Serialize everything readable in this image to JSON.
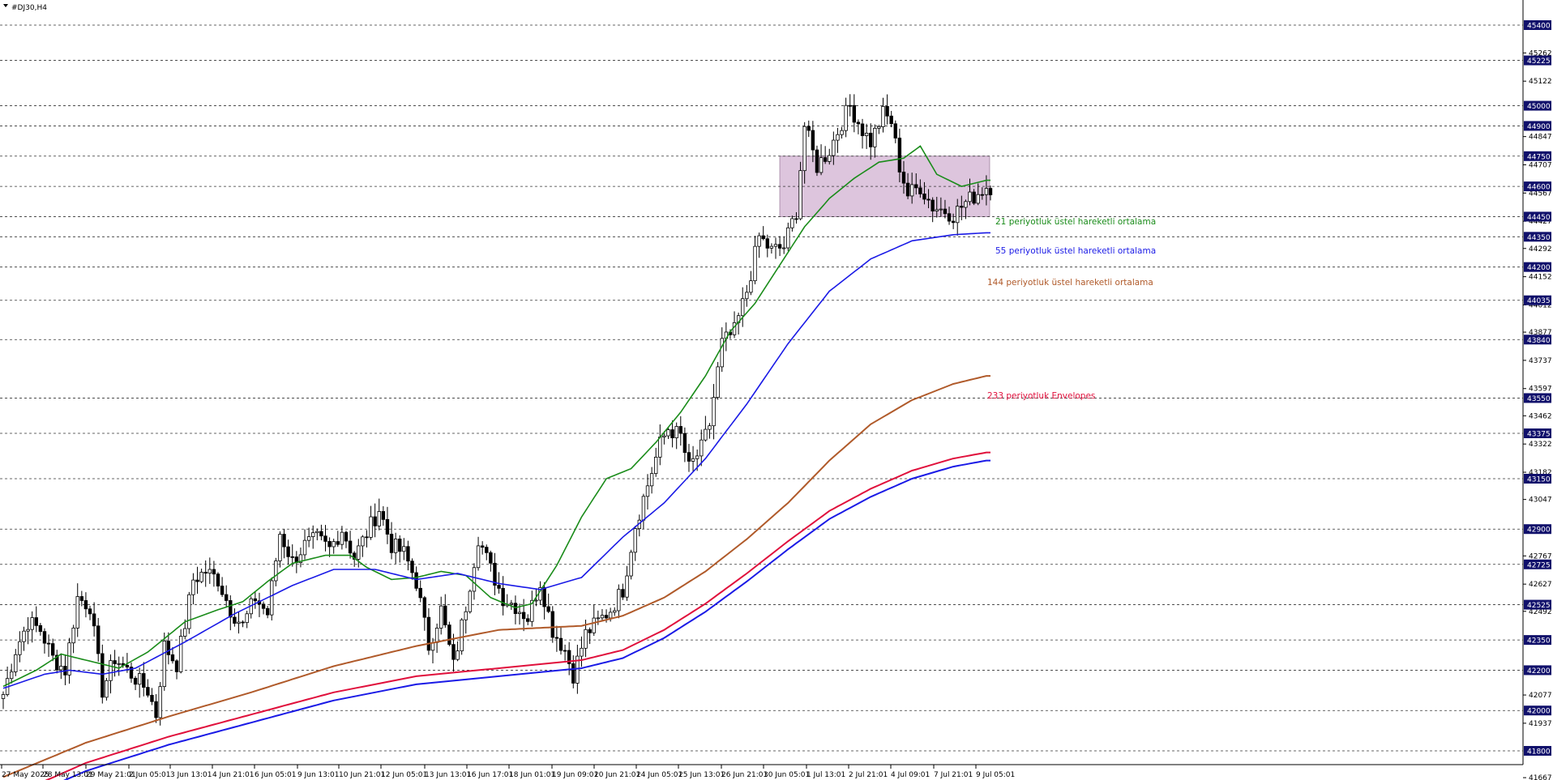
{
  "window": {
    "title": "#DJ30,H4"
  },
  "chart_data": {
    "type": "candlestick",
    "symbol": "#DJ30",
    "timeframe": "H4",
    "grid": false,
    "ylim": [
      41640,
      45560
    ],
    "price_levels": [
      45400,
      45225,
      45000,
      44900,
      44750,
      44600,
      44450,
      44350,
      44200,
      44035,
      43840,
      43550,
      43375,
      43150,
      42900,
      42725,
      42525,
      42350,
      42200,
      42000,
      41800
    ],
    "y_ticks": [
      45262,
      45122,
      44847,
      44707,
      44567,
      44427,
      44292,
      44152,
      44012,
      43877,
      43737,
      43597,
      43462,
      43322,
      43182,
      43047,
      42767,
      42627,
      42492,
      42077,
      41937,
      41667
    ],
    "x_ticks": [
      "27 May 2025",
      "28 May 13:01",
      "29 May 21:01",
      "2 Jun 05:01",
      "3 Jun 13:01",
      "4 Jun 21:01",
      "6 Jun 05:01",
      "9 Jun 13:01",
      "10 Jun 21:01",
      "12 Jun 05:01",
      "13 Jun 13:01",
      "16 Jun 17:01",
      "18 Jun 01:01",
      "19 Jun 09:01",
      "20 Jun 21:01",
      "24 Jun 05:01",
      "25 Jun 13:01",
      "26 Jun 21:01",
      "30 Jun 05:01",
      "1 Jul 13:01",
      "2 Jul 21:01",
      "4 Jul 09:01",
      "7 Jul 21:01",
      "9 Jul 05:01"
    ],
    "zone": {
      "from": 44450,
      "to": 44750,
      "color": "#d8bcd8"
    },
    "annotations": [
      {
        "text": "21 periyotluk üstel hareketli ortalama",
        "color": "#1a8c1a"
      },
      {
        "text": "55 periyotluk üstel hareketli ortalama",
        "color": "#1a1ae6"
      },
      {
        "text": "144 periyotluk üstel hareketli ortalama",
        "color": "#b05a2a"
      },
      {
        "text": "233 periyotluk Envelopes",
        "color": "#e0103c"
      }
    ],
    "series": [
      {
        "name": "21 periyotluk üstel hareketli ortalama",
        "color": "#1a8c1a",
        "anchors": [
          [
            0,
            42120
          ],
          [
            8,
            42200
          ],
          [
            14,
            42280
          ],
          [
            20,
            42250
          ],
          [
            28,
            42210
          ],
          [
            35,
            42290
          ],
          [
            44,
            42440
          ],
          [
            52,
            42500
          ],
          [
            58,
            42540
          ],
          [
            64,
            42640
          ],
          [
            70,
            42730
          ],
          [
            78,
            42770
          ],
          [
            84,
            42770
          ],
          [
            88,
            42710
          ],
          [
            94,
            42650
          ],
          [
            100,
            42660
          ],
          [
            106,
            42690
          ],
          [
            112,
            42670
          ],
          [
            118,
            42560
          ],
          [
            124,
            42510
          ],
          [
            128,
            42530
          ],
          [
            134,
            42720
          ],
          [
            140,
            42960
          ],
          [
            146,
            43150
          ],
          [
            152,
            43200
          ],
          [
            158,
            43330
          ],
          [
            164,
            43480
          ],
          [
            170,
            43660
          ],
          [
            176,
            43880
          ],
          [
            182,
            44020
          ],
          [
            188,
            44210
          ],
          [
            194,
            44400
          ],
          [
            200,
            44540
          ],
          [
            206,
            44640
          ],
          [
            212,
            44720
          ],
          [
            218,
            44740
          ],
          [
            222,
            44800
          ],
          [
            226,
            44660
          ],
          [
            232,
            44600
          ],
          [
            238,
            44630
          ]
        ]
      },
      {
        "name": "55 periyotluk üstel hareketli ortalama",
        "color": "#1a1ae6",
        "anchors": [
          [
            0,
            42110
          ],
          [
            10,
            42180
          ],
          [
            16,
            42200
          ],
          [
            24,
            42180
          ],
          [
            32,
            42210
          ],
          [
            44,
            42340
          ],
          [
            56,
            42480
          ],
          [
            70,
            42620
          ],
          [
            80,
            42700
          ],
          [
            90,
            42700
          ],
          [
            100,
            42650
          ],
          [
            110,
            42680
          ],
          [
            120,
            42630
          ],
          [
            130,
            42600
          ],
          [
            140,
            42660
          ],
          [
            150,
            42860
          ],
          [
            160,
            43030
          ],
          [
            170,
            43250
          ],
          [
            180,
            43520
          ],
          [
            190,
            43820
          ],
          [
            200,
            44080
          ],
          [
            210,
            44240
          ],
          [
            220,
            44330
          ],
          [
            230,
            44360
          ],
          [
            238,
            44370
          ]
        ]
      },
      {
        "name": "144 periyotluk üstel hareketli ortalama",
        "color": "#b05a2a",
        "anchors": [
          [
            0,
            41670
          ],
          [
            20,
            41840
          ],
          [
            40,
            41970
          ],
          [
            60,
            42090
          ],
          [
            80,
            42220
          ],
          [
            100,
            42320
          ],
          [
            120,
            42400
          ],
          [
            140,
            42420
          ],
          [
            150,
            42470
          ],
          [
            160,
            42560
          ],
          [
            170,
            42690
          ],
          [
            180,
            42850
          ],
          [
            190,
            43030
          ],
          [
            200,
            43240
          ],
          [
            210,
            43420
          ],
          [
            220,
            43540
          ],
          [
            230,
            43620
          ],
          [
            238,
            43660
          ]
        ]
      },
      {
        "name": "233 periyotluk Envelopes",
        "color": "#e0103c",
        "anchors": [
          [
            0,
            41560
          ],
          [
            20,
            41740
          ],
          [
            40,
            41870
          ],
          [
            60,
            41980
          ],
          [
            80,
            42090
          ],
          [
            100,
            42170
          ],
          [
            120,
            42210
          ],
          [
            140,
            42250
          ],
          [
            150,
            42300
          ],
          [
            160,
            42400
          ],
          [
            170,
            42530
          ],
          [
            180,
            42680
          ],
          [
            190,
            42840
          ],
          [
            200,
            42990
          ],
          [
            210,
            43100
          ],
          [
            220,
            43190
          ],
          [
            230,
            43250
          ],
          [
            238,
            43280
          ]
        ]
      },
      {
        "name": "",
        "color": "#1a1ae6",
        "anchors": [
          [
            0,
            41520
          ],
          [
            20,
            41700
          ],
          [
            40,
            41830
          ],
          [
            60,
            41940
          ],
          [
            80,
            42050
          ],
          [
            100,
            42130
          ],
          [
            120,
            42170
          ],
          [
            140,
            42210
          ],
          [
            150,
            42260
          ],
          [
            160,
            42360
          ],
          [
            170,
            42490
          ],
          [
            180,
            42640
          ],
          [
            190,
            42800
          ],
          [
            200,
            42950
          ],
          [
            210,
            43060
          ],
          [
            220,
            43150
          ],
          [
            230,
            43210
          ],
          [
            238,
            43240
          ]
        ]
      }
    ],
    "price_anchors": [
      [
        0,
        42080
      ],
      [
        3,
        42300
      ],
      [
        6,
        42440
      ],
      [
        9,
        42400
      ],
      [
        12,
        42260
      ],
      [
        15,
        42200
      ],
      [
        18,
        42560
      ],
      [
        21,
        42520
      ],
      [
        24,
        42100
      ],
      [
        27,
        42260
      ],
      [
        30,
        42200
      ],
      [
        33,
        42140
      ],
      [
        35,
        42100
      ],
      [
        37,
        41980
      ],
      [
        39,
        42320
      ],
      [
        42,
        42230
      ],
      [
        44,
        42430
      ],
      [
        46,
        42650
      ],
      [
        49,
        42690
      ],
      [
        52,
        42650
      ],
      [
        55,
        42500
      ],
      [
        58,
        42420
      ],
      [
        61,
        42560
      ],
      [
        64,
        42480
      ],
      [
        67,
        42880
      ],
      [
        70,
        42740
      ],
      [
        73,
        42820
      ],
      [
        76,
        42850
      ],
      [
        79,
        42800
      ],
      [
        82,
        42900
      ],
      [
        85,
        42760
      ],
      [
        88,
        42880
      ],
      [
        91,
        43000
      ],
      [
        94,
        42820
      ],
      [
        97,
        42780
      ],
      [
        100,
        42640
      ],
      [
        103,
        42320
      ],
      [
        106,
        42500
      ],
      [
        109,
        42220
      ],
      [
        112,
        42520
      ],
      [
        115,
        42860
      ],
      [
        118,
        42700
      ],
      [
        121,
        42560
      ],
      [
        124,
        42520
      ],
      [
        127,
        42460
      ],
      [
        130,
        42640
      ],
      [
        133,
        42400
      ],
      [
        136,
        42300
      ],
      [
        138,
        42180
      ],
      [
        141,
        42380
      ],
      [
        144,
        42440
      ],
      [
        147,
        42500
      ],
      [
        150,
        42600
      ],
      [
        153,
        42920
      ],
      [
        156,
        43120
      ],
      [
        159,
        43320
      ],
      [
        161,
        43400
      ],
      [
        164,
        43360
      ],
      [
        166,
        43200
      ],
      [
        169,
        43300
      ],
      [
        171,
        43420
      ],
      [
        174,
        43820
      ],
      [
        177,
        43880
      ],
      [
        180,
        44080
      ],
      [
        183,
        44350
      ],
      [
        186,
        44280
      ],
      [
        189,
        44300
      ],
      [
        192,
        44480
      ],
      [
        194,
        44900
      ],
      [
        197,
        44700
      ],
      [
        200,
        44780
      ],
      [
        203,
        44920
      ],
      [
        205,
        45000
      ],
      [
        208,
        44880
      ],
      [
        210,
        44820
      ],
      [
        213,
        44960
      ],
      [
        215,
        44920
      ],
      [
        217,
        44700
      ],
      [
        219,
        44560
      ],
      [
        222,
        44600
      ],
      [
        225,
        44500
      ],
      [
        228,
        44480
      ],
      [
        230,
        44460
      ],
      [
        233,
        44520
      ],
      [
        238,
        44600
      ]
    ]
  }
}
